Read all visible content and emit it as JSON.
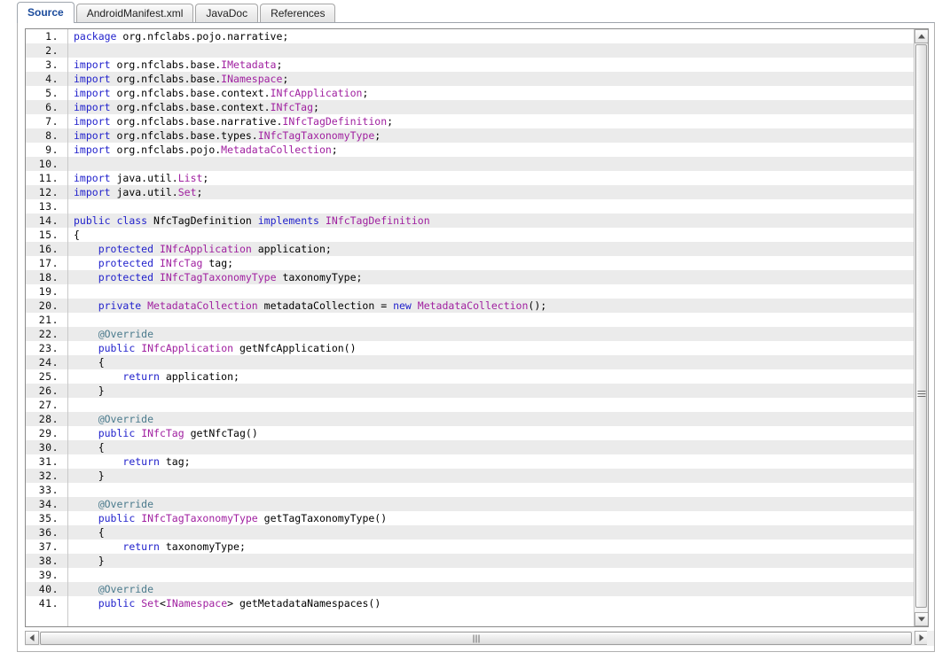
{
  "tabs": [
    {
      "label": "Source",
      "active": true
    },
    {
      "label": "AndroidManifest.xml",
      "active": false
    },
    {
      "label": "JavaDoc",
      "active": false
    },
    {
      "label": "References",
      "active": false
    }
  ],
  "editor": {
    "first_visible_line": 1,
    "last_visible_line": 41,
    "language": "java",
    "colors": {
      "keyword": "#2222cc",
      "type": "#a020a0",
      "annotation": "#4a7a8c",
      "plain": "#000000",
      "alt_row_background": "#ebebeb",
      "background": "#ffffff",
      "line_number": "#111111",
      "active_tab_text": "#1b4b9c"
    },
    "lines": [
      {
        "n": "1.",
        "tokens": [
          {
            "t": "package",
            "c": "kw"
          },
          {
            "t": " org.nfclabs.pojo.narrative;",
            "c": "pl"
          }
        ]
      },
      {
        "n": "2.",
        "tokens": []
      },
      {
        "n": "3.",
        "tokens": [
          {
            "t": "import",
            "c": "kw"
          },
          {
            "t": " org.nfclabs.base.",
            "c": "pl"
          },
          {
            "t": "IMetadata",
            "c": "typ"
          },
          {
            "t": ";",
            "c": "pl"
          }
        ]
      },
      {
        "n": "4.",
        "tokens": [
          {
            "t": "import",
            "c": "kw"
          },
          {
            "t": " org.nfclabs.base.",
            "c": "pl"
          },
          {
            "t": "INamespace",
            "c": "typ"
          },
          {
            "t": ";",
            "c": "pl"
          }
        ]
      },
      {
        "n": "5.",
        "tokens": [
          {
            "t": "import",
            "c": "kw"
          },
          {
            "t": " org.nfclabs.base.context.",
            "c": "pl"
          },
          {
            "t": "INfcApplication",
            "c": "typ"
          },
          {
            "t": ";",
            "c": "pl"
          }
        ]
      },
      {
        "n": "6.",
        "tokens": [
          {
            "t": "import",
            "c": "kw"
          },
          {
            "t": " org.nfclabs.base.context.",
            "c": "pl"
          },
          {
            "t": "INfcTag",
            "c": "typ"
          },
          {
            "t": ";",
            "c": "pl"
          }
        ]
      },
      {
        "n": "7.",
        "tokens": [
          {
            "t": "import",
            "c": "kw"
          },
          {
            "t": " org.nfclabs.base.narrative.",
            "c": "pl"
          },
          {
            "t": "INfcTagDefinition",
            "c": "typ"
          },
          {
            "t": ";",
            "c": "pl"
          }
        ]
      },
      {
        "n": "8.",
        "tokens": [
          {
            "t": "import",
            "c": "kw"
          },
          {
            "t": " org.nfclabs.base.types.",
            "c": "pl"
          },
          {
            "t": "INfcTagTaxonomyType",
            "c": "typ"
          },
          {
            "t": ";",
            "c": "pl"
          }
        ]
      },
      {
        "n": "9.",
        "tokens": [
          {
            "t": "import",
            "c": "kw"
          },
          {
            "t": " org.nfclabs.pojo.",
            "c": "pl"
          },
          {
            "t": "MetadataCollection",
            "c": "typ"
          },
          {
            "t": ";",
            "c": "pl"
          }
        ]
      },
      {
        "n": "10.",
        "tokens": []
      },
      {
        "n": "11.",
        "tokens": [
          {
            "t": "import",
            "c": "kw"
          },
          {
            "t": " java.util.",
            "c": "pl"
          },
          {
            "t": "List",
            "c": "typ"
          },
          {
            "t": ";",
            "c": "pl"
          }
        ]
      },
      {
        "n": "12.",
        "tokens": [
          {
            "t": "import",
            "c": "kw"
          },
          {
            "t": " java.util.",
            "c": "pl"
          },
          {
            "t": "Set",
            "c": "typ"
          },
          {
            "t": ";",
            "c": "pl"
          }
        ]
      },
      {
        "n": "13.",
        "tokens": []
      },
      {
        "n": "14.",
        "tokens": [
          {
            "t": "public",
            "c": "kw"
          },
          {
            "t": " ",
            "c": "pl"
          },
          {
            "t": "class",
            "c": "kw"
          },
          {
            "t": " NfcTagDefinition ",
            "c": "pl"
          },
          {
            "t": "implements",
            "c": "kw"
          },
          {
            "t": " ",
            "c": "pl"
          },
          {
            "t": "INfcTagDefinition",
            "c": "typ"
          }
        ]
      },
      {
        "n": "15.",
        "tokens": [
          {
            "t": "{",
            "c": "pl"
          }
        ]
      },
      {
        "n": "16.",
        "tokens": [
          {
            "t": "    ",
            "c": "pl"
          },
          {
            "t": "protected",
            "c": "kw"
          },
          {
            "t": " ",
            "c": "pl"
          },
          {
            "t": "INfcApplication",
            "c": "typ"
          },
          {
            "t": " application;",
            "c": "pl"
          }
        ]
      },
      {
        "n": "17.",
        "tokens": [
          {
            "t": "    ",
            "c": "pl"
          },
          {
            "t": "protected",
            "c": "kw"
          },
          {
            "t": " ",
            "c": "pl"
          },
          {
            "t": "INfcTag",
            "c": "typ"
          },
          {
            "t": " tag;",
            "c": "pl"
          }
        ]
      },
      {
        "n": "18.",
        "tokens": [
          {
            "t": "    ",
            "c": "pl"
          },
          {
            "t": "protected",
            "c": "kw"
          },
          {
            "t": " ",
            "c": "pl"
          },
          {
            "t": "INfcTagTaxonomyType",
            "c": "typ"
          },
          {
            "t": " taxonomyType;",
            "c": "pl"
          }
        ]
      },
      {
        "n": "19.",
        "tokens": []
      },
      {
        "n": "20.",
        "tokens": [
          {
            "t": "    ",
            "c": "pl"
          },
          {
            "t": "private",
            "c": "kw"
          },
          {
            "t": " ",
            "c": "pl"
          },
          {
            "t": "MetadataCollection",
            "c": "typ"
          },
          {
            "t": " metadataCollection = ",
            "c": "pl"
          },
          {
            "t": "new",
            "c": "kw"
          },
          {
            "t": " ",
            "c": "pl"
          },
          {
            "t": "MetadataCollection",
            "c": "typ"
          },
          {
            "t": "();",
            "c": "pl"
          }
        ]
      },
      {
        "n": "21.",
        "tokens": []
      },
      {
        "n": "22.",
        "tokens": [
          {
            "t": "    ",
            "c": "pl"
          },
          {
            "t": "@Override",
            "c": "ann"
          }
        ]
      },
      {
        "n": "23.",
        "tokens": [
          {
            "t": "    ",
            "c": "pl"
          },
          {
            "t": "public",
            "c": "kw"
          },
          {
            "t": " ",
            "c": "pl"
          },
          {
            "t": "INfcApplication",
            "c": "typ"
          },
          {
            "t": " getNfcApplication()",
            "c": "pl"
          }
        ]
      },
      {
        "n": "24.",
        "tokens": [
          {
            "t": "    {",
            "c": "pl"
          }
        ]
      },
      {
        "n": "25.",
        "tokens": [
          {
            "t": "        ",
            "c": "pl"
          },
          {
            "t": "return",
            "c": "kw"
          },
          {
            "t": " application;",
            "c": "pl"
          }
        ]
      },
      {
        "n": "26.",
        "tokens": [
          {
            "t": "    }",
            "c": "pl"
          }
        ]
      },
      {
        "n": "27.",
        "tokens": []
      },
      {
        "n": "28.",
        "tokens": [
          {
            "t": "    ",
            "c": "pl"
          },
          {
            "t": "@Override",
            "c": "ann"
          }
        ]
      },
      {
        "n": "29.",
        "tokens": [
          {
            "t": "    ",
            "c": "pl"
          },
          {
            "t": "public",
            "c": "kw"
          },
          {
            "t": " ",
            "c": "pl"
          },
          {
            "t": "INfcTag",
            "c": "typ"
          },
          {
            "t": " getNfcTag()",
            "c": "pl"
          }
        ]
      },
      {
        "n": "30.",
        "tokens": [
          {
            "t": "    {",
            "c": "pl"
          }
        ]
      },
      {
        "n": "31.",
        "tokens": [
          {
            "t": "        ",
            "c": "pl"
          },
          {
            "t": "return",
            "c": "kw"
          },
          {
            "t": " tag;",
            "c": "pl"
          }
        ]
      },
      {
        "n": "32.",
        "tokens": [
          {
            "t": "    }",
            "c": "pl"
          }
        ]
      },
      {
        "n": "33.",
        "tokens": []
      },
      {
        "n": "34.",
        "tokens": [
          {
            "t": "    ",
            "c": "pl"
          },
          {
            "t": "@Override",
            "c": "ann"
          }
        ]
      },
      {
        "n": "35.",
        "tokens": [
          {
            "t": "    ",
            "c": "pl"
          },
          {
            "t": "public",
            "c": "kw"
          },
          {
            "t": " ",
            "c": "pl"
          },
          {
            "t": "INfcTagTaxonomyType",
            "c": "typ"
          },
          {
            "t": " getTagTaxonomyType()",
            "c": "pl"
          }
        ]
      },
      {
        "n": "36.",
        "tokens": [
          {
            "t": "    {",
            "c": "pl"
          }
        ]
      },
      {
        "n": "37.",
        "tokens": [
          {
            "t": "        ",
            "c": "pl"
          },
          {
            "t": "return",
            "c": "kw"
          },
          {
            "t": " taxonomyType;",
            "c": "pl"
          }
        ]
      },
      {
        "n": "38.",
        "tokens": [
          {
            "t": "    }",
            "c": "pl"
          }
        ]
      },
      {
        "n": "39.",
        "tokens": []
      },
      {
        "n": "40.",
        "tokens": [
          {
            "t": "    ",
            "c": "pl"
          },
          {
            "t": "@Override",
            "c": "ann"
          }
        ]
      },
      {
        "n": "41.",
        "tokens": [
          {
            "t": "    ",
            "c": "pl"
          },
          {
            "t": "public",
            "c": "kw"
          },
          {
            "t": " ",
            "c": "pl"
          },
          {
            "t": "Set",
            "c": "typ"
          },
          {
            "t": "<",
            "c": "pl"
          },
          {
            "t": "INamespace",
            "c": "typ"
          },
          {
            "t": "> getMetadataNamespaces()",
            "c": "pl"
          }
        ]
      }
    ]
  },
  "scrollbars": {
    "vertical": {
      "up_arrow": "arrow-up-icon",
      "down_arrow": "arrow-down-icon",
      "grip": "grip-icon"
    },
    "horizontal": {
      "left_arrow": "arrow-left-icon",
      "right_arrow": "arrow-right-icon",
      "grip": "grip-icon"
    }
  }
}
